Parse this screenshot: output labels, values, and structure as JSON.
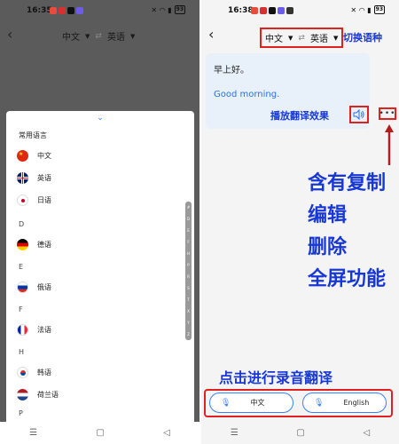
{
  "left": {
    "status": {
      "time": "16:35",
      "battery": "93"
    },
    "lang_switch": {
      "source": "中文",
      "target": "英语",
      "swap": "⇄"
    },
    "sheet": {
      "header": "常用语言",
      "common": [
        {
          "label": "中文",
          "flag": "cn"
        },
        {
          "label": "英语",
          "flag": "uk"
        },
        {
          "label": "日语",
          "flag": "jp"
        }
      ],
      "sections": [
        {
          "letter": "D",
          "items": [
            {
              "label": "德语",
              "flag": "de"
            }
          ]
        },
        {
          "letter": "E",
          "items": [
            {
              "label": "俄语",
              "flag": "ru"
            }
          ]
        },
        {
          "letter": "F",
          "items": [
            {
              "label": "法语",
              "flag": "fr"
            }
          ]
        },
        {
          "letter": "H",
          "items": [
            {
              "label": "韩语",
              "flag": "kr"
            },
            {
              "label": "荷兰语",
              "flag": "nl"
            }
          ]
        },
        {
          "letter": "P",
          "items": []
        }
      ],
      "index_letters": [
        "#",
        "D",
        "E",
        "F",
        "H",
        "P",
        "R",
        "S",
        "T",
        "X",
        "Y",
        "Z"
      ]
    }
  },
  "right": {
    "status": {
      "time": "16:38",
      "battery": "93"
    },
    "lang_switch": {
      "source": "中文",
      "target": "英语",
      "swap": "⇄"
    },
    "card": {
      "source_text": "早上好。",
      "target_text": "Good morning."
    },
    "annotations": {
      "switch": "切换语种",
      "play": "播放翻译效果",
      "features": [
        "含有复制",
        "编辑",
        "删除",
        "全屏功能"
      ],
      "record": "点击进行录音翻译"
    },
    "record_buttons": {
      "chinese": "中文",
      "english": "English"
    }
  },
  "nav": {
    "menu": "☰",
    "home": "▢",
    "back": "◁"
  },
  "colors": {
    "annotation": "#1737d8",
    "highlight": "#e0211f",
    "accent": "#2a6fe8"
  }
}
